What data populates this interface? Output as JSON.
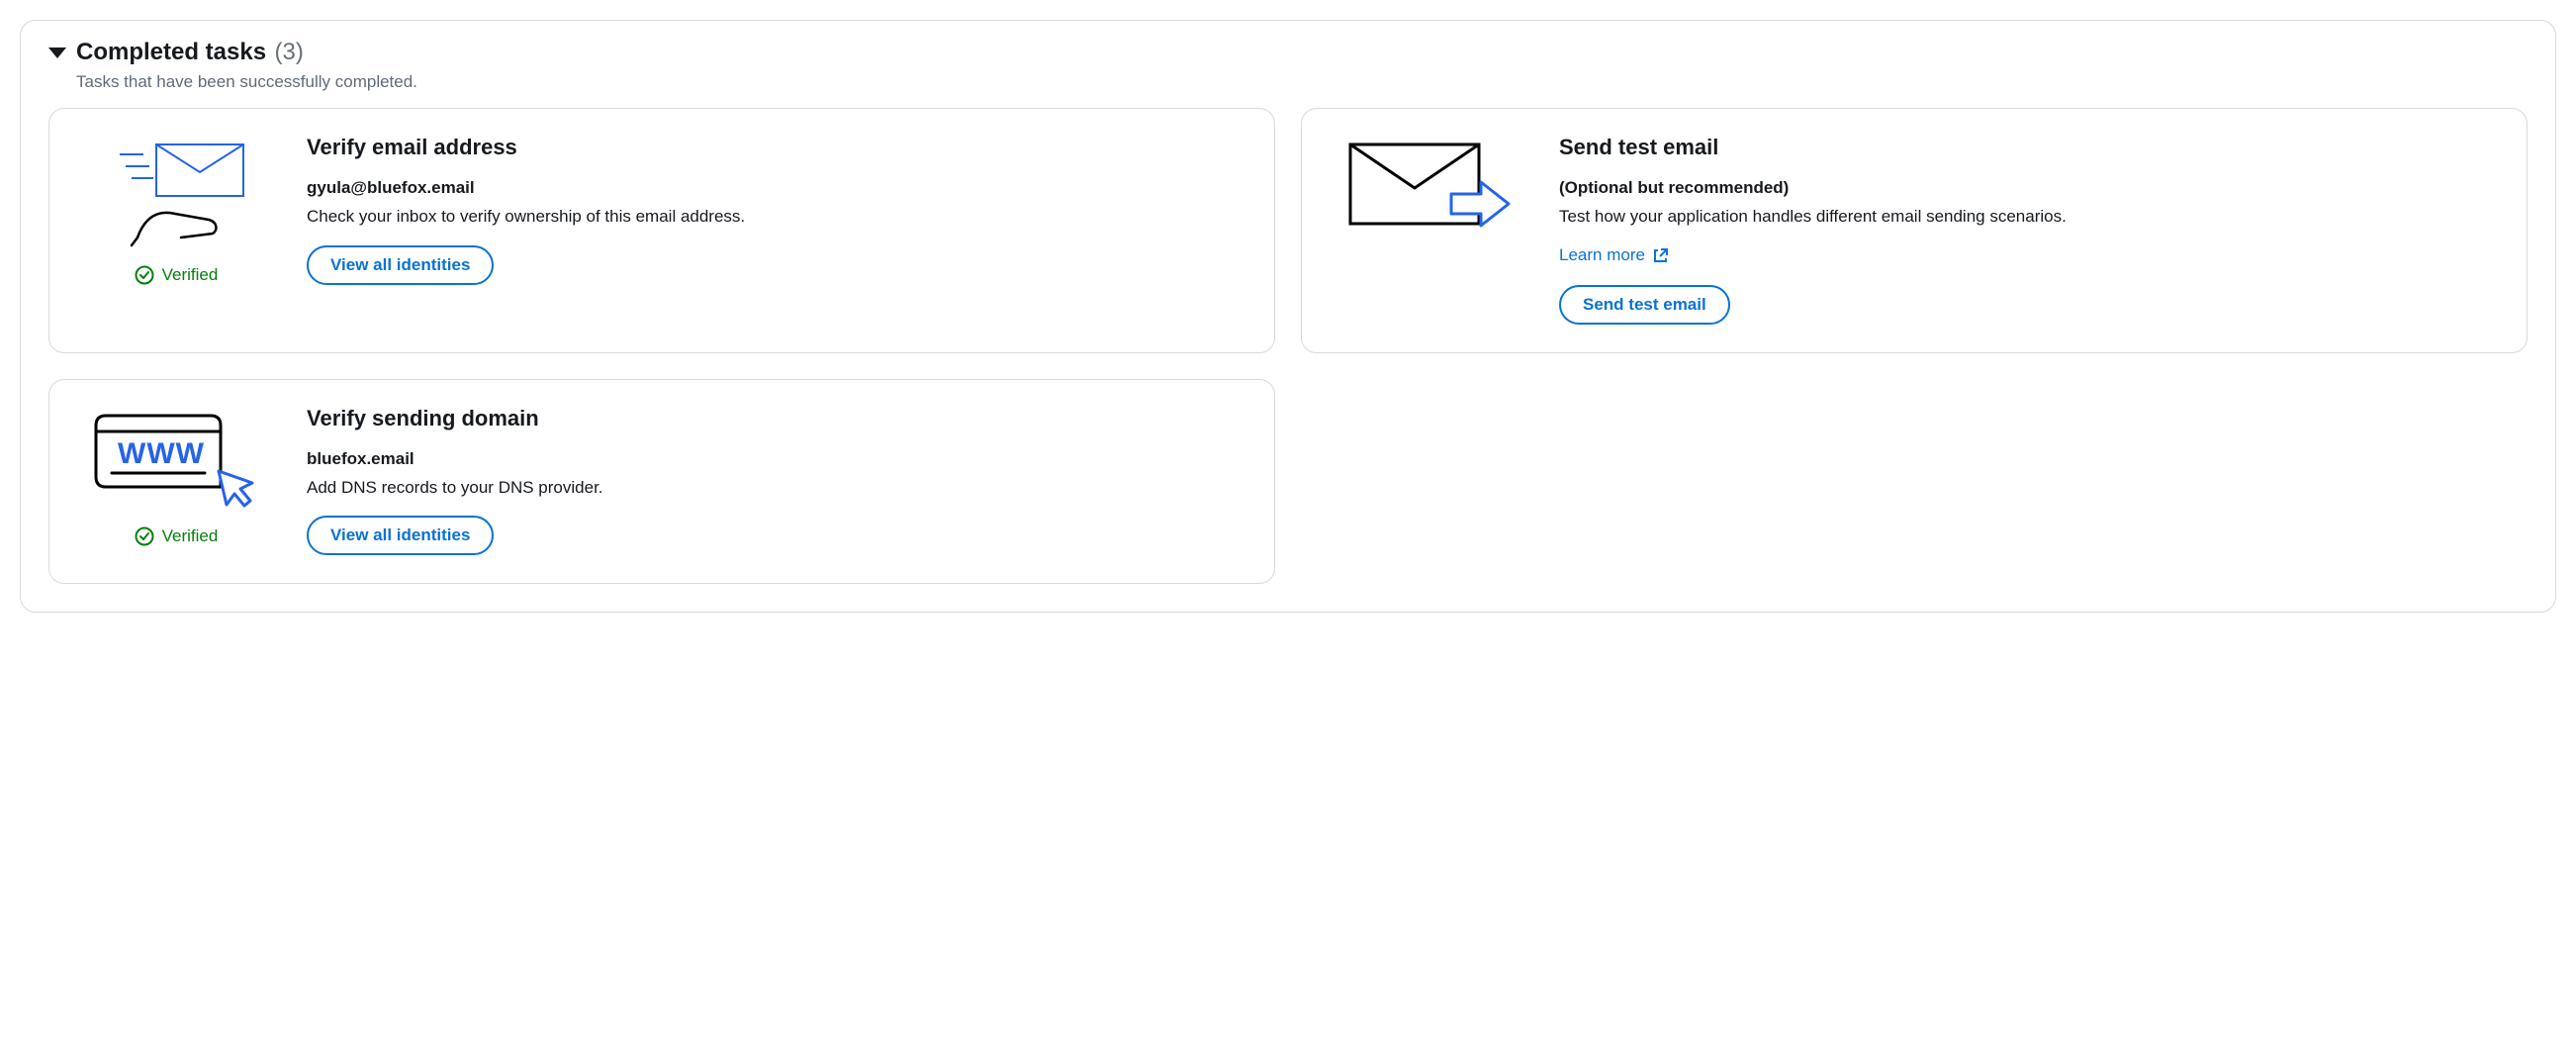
{
  "header": {
    "title": "Completed tasks",
    "count": "(3)",
    "subtitle": "Tasks that have been successfully completed."
  },
  "verified_label": "Verified",
  "cards": {
    "verify_email": {
      "title": "Verify email address",
      "value": "gyula@bluefox.email",
      "desc": "Check your inbox to verify ownership of this email address.",
      "button": "View all identities"
    },
    "send_test": {
      "title": "Send test email",
      "subtitle": "(Optional but recommended)",
      "desc": "Test how your application handles different email sending scenarios.",
      "learn_more": "Learn more",
      "button": "Send test email"
    },
    "verify_domain": {
      "title": "Verify sending domain",
      "value": "bluefox.email",
      "desc": "Add DNS records to your DNS provider.",
      "button": "View all identities"
    }
  }
}
